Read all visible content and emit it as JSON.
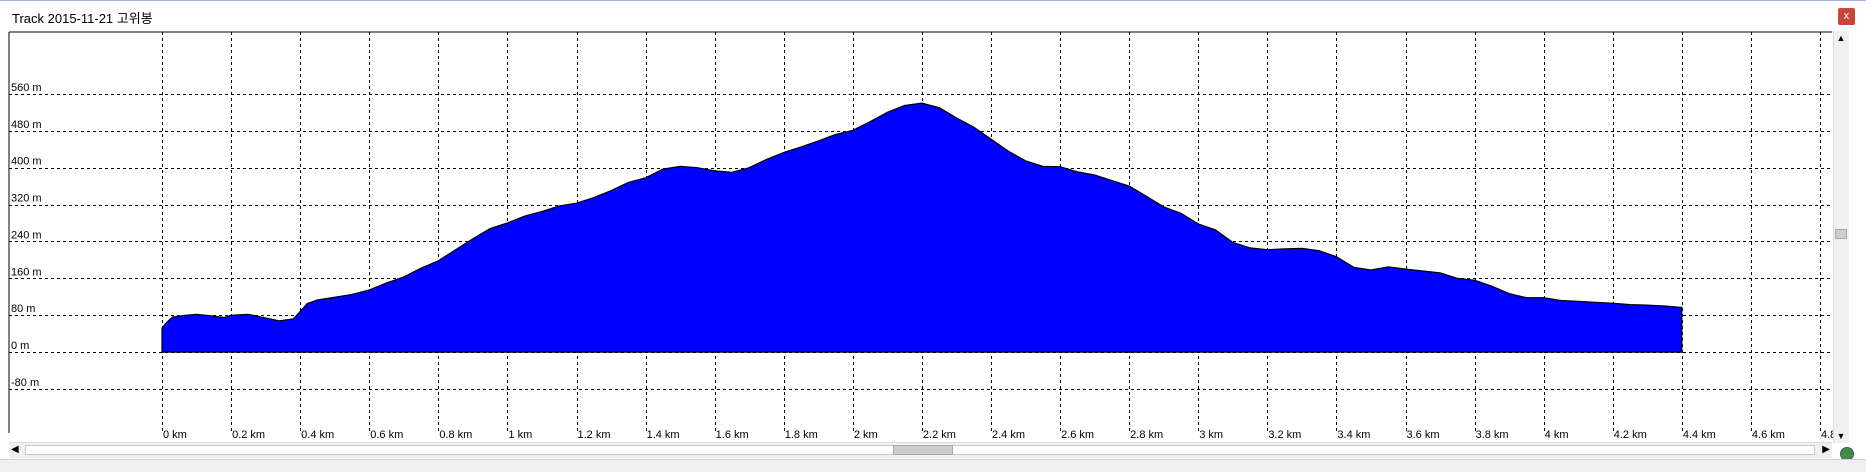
{
  "window": {
    "title": "Track 2015-11-21 고위봉",
    "close_label": "x"
  },
  "colors": {
    "fill": "#0000ff",
    "stroke": "#000000",
    "grid": "#000000"
  },
  "chart_data": {
    "type": "area",
    "title": "",
    "xlabel": "",
    "ylabel": "",
    "grid": true,
    "xlim": [
      0,
      4.8
    ],
    "ylim": [
      -80,
      640
    ],
    "x_ticks": [
      "0 km",
      "0.2 km",
      "0.4 km",
      "0.6 km",
      "0.8 km",
      "1 km",
      "1.2 km",
      "1.4 km",
      "1.6 km",
      "1.8 km",
      "2 km",
      "2.2 km",
      "2.4 km",
      "2.6 km",
      "2.8 km",
      "3 km",
      "3.2 km",
      "3.4 km",
      "3.6 km",
      "3.8 km",
      "4 km",
      "4.2 km",
      "4.4 km",
      "4.6 km",
      "4.8"
    ],
    "x_tick_values": [
      0,
      0.2,
      0.4,
      0.6,
      0.8,
      1.0,
      1.2,
      1.4,
      1.6,
      1.8,
      2.0,
      2.2,
      2.4,
      2.6,
      2.8,
      3.0,
      3.2,
      3.4,
      3.6,
      3.8,
      4.0,
      4.2,
      4.4,
      4.6,
      4.8
    ],
    "y_ticks": [
      "560 m",
      "480 m",
      "400 m",
      "320 m",
      "240 m",
      "160 m",
      "80 m",
      "0 m",
      "-80 m"
    ],
    "y_tick_values": [
      560,
      480,
      400,
      320,
      240,
      160,
      80,
      0,
      -80
    ],
    "series": [
      {
        "x": [
          0,
          0.01,
          0.03,
          0.07,
          0.1,
          0.14,
          0.18,
          0.2,
          0.25,
          0.3,
          0.34,
          0.38,
          0.4,
          0.42,
          0.45,
          0.5,
          0.55,
          0.6,
          0.65,
          0.7,
          0.75,
          0.8,
          0.85,
          0.9,
          0.95,
          1.0,
          1.05,
          1.1,
          1.15,
          1.2,
          1.25,
          1.3,
          1.35,
          1.4,
          1.45,
          1.5,
          1.55,
          1.6,
          1.65,
          1.7,
          1.75,
          1.8,
          1.85,
          1.9,
          1.95,
          2.0,
          2.05,
          2.1,
          2.15,
          2.2,
          2.25,
          2.3,
          2.35,
          2.4,
          2.45,
          2.5,
          2.55,
          2.6,
          2.65,
          2.7,
          2.75,
          2.8,
          2.85,
          2.9,
          2.95,
          3.0,
          3.05,
          3.1,
          3.15,
          3.2,
          3.25,
          3.3,
          3.35,
          3.4,
          3.45,
          3.5,
          3.55,
          3.6,
          3.65,
          3.7,
          3.75,
          3.8,
          3.85,
          3.9,
          3.95,
          4.0,
          4.05,
          4.1,
          4.15,
          4.2,
          4.25,
          4.3,
          4.35,
          4.4
        ],
        "y": [
          52,
          62,
          76,
          80,
          82,
          79,
          75,
          80,
          82,
          74,
          68,
          72,
          88,
          105,
          113,
          119,
          125,
          135,
          150,
          163,
          182,
          198,
          222,
          246,
          268,
          280,
          295,
          305,
          317,
          323,
          335,
          350,
          368,
          378,
          397,
          403,
          400,
          393,
          390,
          400,
          418,
          433,
          445,
          458,
          472,
          481,
          500,
          520,
          535,
          540,
          530,
          508,
          488,
          462,
          436,
          415,
          403,
          402,
          391,
          384,
          372,
          360,
          338,
          315,
          301,
          278,
          265,
          238,
          226,
          222,
          224,
          225,
          220,
          207,
          184,
          178,
          185,
          180,
          176,
          172,
          160,
          156,
          143,
          127,
          118,
          118,
          112,
          110,
          108,
          106,
          103,
          102,
          100,
          97
        ]
      }
    ]
  }
}
